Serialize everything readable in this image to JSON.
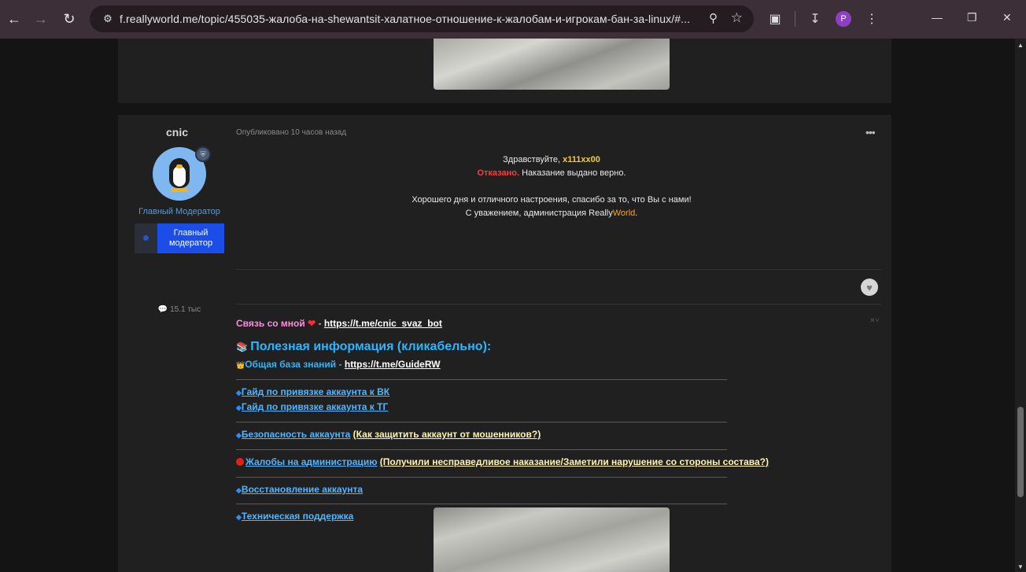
{
  "browser": {
    "url": "f.reallyworld.me/topic/455035-жалоба-на-shewantsit-халатное-отношение-к-жалобам-и-игрокам-бан-за-linux/#...",
    "profile_initial": "P",
    "icons": [
      "back-icon",
      "forward-icon",
      "reload-icon",
      "site-info-icon",
      "zoom-icon",
      "star-icon",
      "extensions-icon",
      "downloads-icon",
      "menu-icon",
      "minimize-icon",
      "maximize-icon",
      "close-icon"
    ]
  },
  "post": {
    "author": {
      "username": "cnic",
      "role_title": "Главный Модератор",
      "role_badge": "Главный модератор",
      "message_count": "15.1 тыс"
    },
    "meta": "Опубликовано 10 часов назад",
    "greeting_prefix": "Здравствуйте, ",
    "greeting_name": "x111xx00",
    "verdict_label": "Отказано.",
    "verdict_text": " Наказание выдано верно.",
    "closing_1": "Хорошего дня и отличного настроения, спасибо за то, что Вы с нами!",
    "closing_2_prefix": "С уважением, администрация Really",
    "closing_2_brand": "World",
    "closing_2_suffix": "."
  },
  "signature": {
    "contact_label": "Связь со мной",
    "contact_sep": " - ",
    "contact_link": "https://t.me/cnic_svaz_bot",
    "info_title": "Полезная информация (кликабельно):",
    "kb_label": "Общая база знаний - ",
    "kb_link": "https://t.me/GuideRW",
    "links": {
      "vk": "Гайд по привязке аккаунта к ВК",
      "tg": "Гайд по привязке аккаунта к ТГ",
      "security": "Безопасность аккаунта",
      "security_note": "(Как защитить аккаунт от мошенников?)",
      "complaints": "Жалобы на администрацию",
      "complaints_note": "(Получили несправедливое наказание/Заметили нарушение со стороны состава?)",
      "recovery": "Восстановление аккаунта",
      "support": "Техническая поддержка"
    }
  },
  "colors": {
    "accent_blue": "#2cb6ff",
    "badge_blue": "#1c4de6",
    "verdict_red": "#ff3b3b",
    "name_yellow": "#f2cf2d"
  }
}
